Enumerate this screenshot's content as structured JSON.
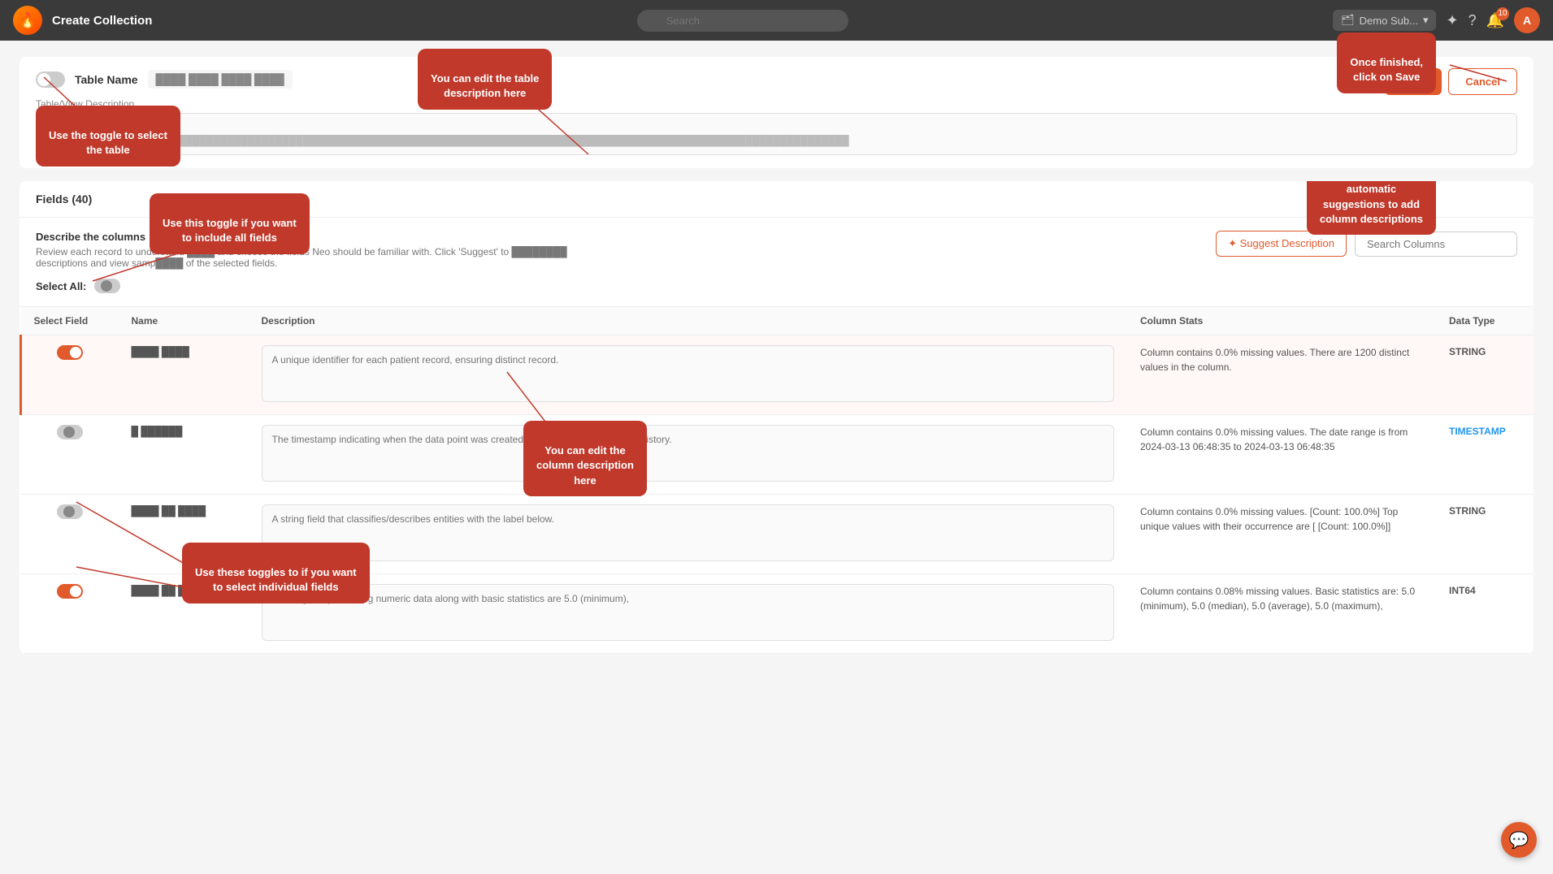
{
  "topnav": {
    "logo_text": "🔥",
    "title": "Create Collection",
    "search_placeholder": "Search",
    "dropdown_label": "Demo Sub...",
    "notification_count": "10",
    "avatar_letter": "A",
    "magic_icon": "✦",
    "help_icon": "?",
    "bell_icon": "🔔"
  },
  "header": {
    "toggle_state": "off",
    "table_name_label": "Table Name",
    "table_name_value": "████ ████ ████ ████",
    "desc_label": "Table/View Description",
    "desc_placeholder": "TableView Description",
    "desc_value": "This table contains ████████████████████████████████████████████████████████████████████████████████████████████████████████",
    "save_label": "Save",
    "cancel_label": "Cancel"
  },
  "fields_section": {
    "title": "Fields (40)",
    "describe_title": "Describe the columns",
    "describe_subtitle": "Review each record to understand ████ and choose the fields Neo should be familiar with. Click 'Suggest' to ████████ descriptions and view samp████ of the selected fields.",
    "select_all_label": "Select All:",
    "suggest_btn_label": "✦ Suggest Description",
    "search_columns_placeholder": "Search Columns",
    "columns_header": "Name",
    "description_header": "Description",
    "stats_header": "Column Stats",
    "type_header": "Data Type",
    "select_field_header": "Select Field"
  },
  "rows": [
    {
      "toggle": "on",
      "name": "████ ████",
      "description_placeholder": "A unique identifier for each patient record, ensuring distinct record.",
      "stats": "Column contains 0.0% missing values. There are 1200 distinct values in the column.",
      "type": "STRING",
      "highlighted": true
    },
    {
      "toggle": "half",
      "name": "█ ██████",
      "description_placeholder": "The timestamp indicating when the data point was created, useful for tracking update history.",
      "stats": "Column contains 0.0% missing values. The date range is from 2024-03-13 06:48:35 to 2024-03-13 06:48:35",
      "type": "TIMESTAMP",
      "highlighted": false
    },
    {
      "toggle": "half",
      "name": "████ ██ ████",
      "description_placeholder": "A string field that classifies/describes entities with the label below.",
      "stats": "Column contains 0.0% missing values. [Count: 100.0%] Top unique values with their occurrence are [ [Count: 100.0%]]",
      "type": "STRING",
      "highlighted": false
    },
    {
      "toggle": "on",
      "name": "████ ██ ████",
      "description_placeholder": "An integer representing numeric data along with basic statistics are 5.0 (minimum),",
      "stats": "Column contains 0.08% missing values. Basic statistics are: 5.0 (minimum), 5.0 (median), 5.0 (average), 5.0 (maximum),",
      "type": "INT64",
      "highlighted": false
    }
  ],
  "annotations": {
    "toggle_table": "Use the toggle to select\nthe table",
    "edit_table_desc": "You can edit the table\ndescription here",
    "save_note": "Once finished,\nclick on Save",
    "include_all": "Use this toggle if you want\nto include all fields",
    "edit_col_desc": "You can edit the\ncolumn description\nhere",
    "suggest_note": "You can use\nautomatic\nsuggestions to add\ncolumn descriptions",
    "individual_toggles": "Use these toggles to if you want\nto select individual fields"
  }
}
